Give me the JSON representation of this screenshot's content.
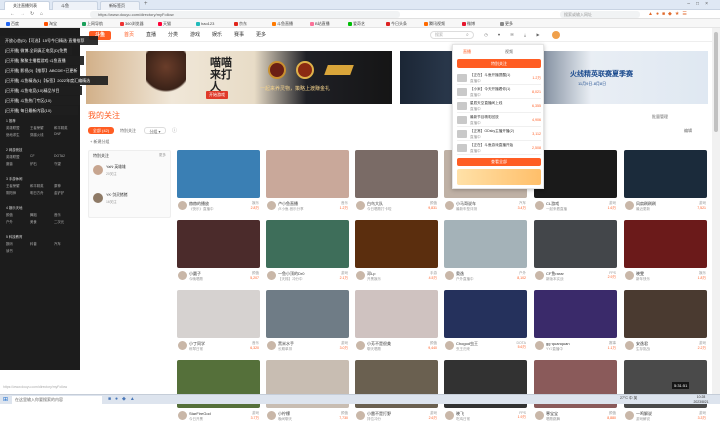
{
  "browser": {
    "tabs": [
      "关注直播列表",
      "斗鱼",
      "新标签页"
    ],
    "url": "https://www.douyu.com/directory/myFollow",
    "address_label": "搜索或输入网址",
    "bookmarks": [
      "百度",
      "淘宝",
      "上网导航",
      "360浏览器",
      "天猫",
      "hao123",
      "京东",
      "斗鱼直播",
      "B站直播",
      "爱奇艺",
      "今日头条",
      "腾讯视频",
      "微博",
      "更多"
    ]
  },
  "site": {
    "logo": "斗鱼",
    "nav": [
      "首页",
      "直播",
      "分类",
      "游戏",
      "娱乐",
      "赛事",
      "更多"
    ],
    "search_placeholder": "搜索",
    "header_icons": [
      "历史",
      "关注",
      "消息",
      "下载",
      "开播"
    ]
  },
  "banner": {
    "tag": "开始游戏",
    "text_left": "喵喵来打人",
    "text_mid": "一起来养灵物，策略上渡赚金礼",
    "text_right": "火线精英联赛夏季赛",
    "date_right": "11月9日-8月8日"
  },
  "sidebar": {
    "overlay_items": [
      "开放心态(D)【可选】15号今日精选·直播推荐",
      "[已开播] 微博-全网真正电竞(D)免费",
      "[已开播] 聚聚主播看游戏·斗鱼直播",
      "[已开播] 影视(0)【推荐】ABCDE+已更新",
      "[已开播] 斗鱼精选(1)【标签】2022年度汇编精选",
      "[已开播] 斗鱼电竞(10)精品节目",
      "[已开播] 斗鱼热门专区(10)",
      "[已开播] 每日最新内容(10)"
    ],
    "sections": [
      {
        "title": "1 推荐",
        "items": [
          "英雄联盟",
          "王者荣耀",
          "和平精英",
          "绝地求生",
          "穿越火线",
          "DNF"
        ]
      },
      {
        "title": "2 网游竞技",
        "items": [
          "英雄联盟",
          "CF",
          "DOTA2",
          "魔兽",
          "炉石",
          "守望"
        ]
      },
      {
        "title": "3 手游休闲",
        "items": [
          "王者荣耀",
          "和平精英",
          "原神",
          "阴阳师",
          "明日方舟",
          "金铲铲"
        ]
      },
      {
        "title": "4 娱乐天地",
        "items": [
          "颜值",
          "舞蹈",
          "音乐",
          "户外",
          "美食",
          "二次元"
        ]
      },
      {
        "title": "5 科技教育",
        "items": [
          "数码",
          "科普",
          "汽车",
          "读书"
        ]
      }
    ],
    "footer": "https://www.douyu.com/directory/myFollow"
  },
  "main": {
    "title": "我的关注",
    "filters": [
      "全部 (42)",
      "特别关注",
      "分组"
    ],
    "add_group": "+ 新建分组",
    "top_right_actions": [
      "批量管理",
      "编辑"
    ],
    "card_small_label": "更多",
    "special_card": {
      "header": "特别关注",
      "items": [
        {
          "name": "YaN·英雄雄",
          "meta": "20关注"
        },
        {
          "name": "YK·剑灵猪猪",
          "meta": "16关注"
        }
      ]
    },
    "cards": [
      {
        "name": "赫赫的播放",
        "meta": "《快乐》直播中",
        "heat": "2.8万",
        "tag": "娱乐",
        "color": "#3a7fb4"
      },
      {
        "name": "卢小鱼直播",
        "meta": "卢小鱼-音乐分享",
        "heat": "1.2万",
        "tag": "音乐",
        "color": "#c9a89a"
      },
      {
        "name": "白鸟大队",
        "meta": "今日唱歌打卡啦",
        "heat": "9,831",
        "tag": "颜值",
        "color": "#7a6b66"
      },
      {
        "name": "小马哥说车",
        "meta": "最新车型评测",
        "heat": "3.4万",
        "tag": "汽车",
        "color": "#bfb1a5"
      },
      {
        "name": "CL游戏",
        "meta": "一起来看直播",
        "heat": "1.6万",
        "tag": "游戏",
        "color": "#1a1a1a"
      },
      {
        "name": "风扇刷刷刷",
        "meta": "最近更新",
        "heat": "7,521",
        "tag": "游戏",
        "color": "#1b2b3b"
      },
      {
        "name": "小圆子",
        "meta": "今晚唱歌",
        "heat": "5,207",
        "tag": "颜值",
        "color": "#4b2b2b"
      },
      {
        "name": "一鱼小顶的Dr0",
        "meta": "【天梯】冲分中",
        "heat": "2.1万",
        "tag": "游戏",
        "color": "#3e6e5a"
      },
      {
        "name": "邓Lp",
        "meta": "开黑娱乐",
        "heat": "4.5万",
        "tag": "手游",
        "color": "#5b2e0e"
      },
      {
        "name": "奥逸",
        "meta": "户外直播中",
        "heat": "8,102",
        "tag": "户外",
        "color": "#a4b2b8"
      },
      {
        "name": "CF鱼rarar",
        "meta": "新版本实战",
        "heat": "2.9万",
        "tag": "FPS",
        "color": "#43464a"
      },
      {
        "name": "晓雯",
        "meta": "新年快乐",
        "heat": "1.8万",
        "tag": "娱乐",
        "color": "#6b1a1a"
      },
      {
        "name": "小丁同学",
        "meta": "练琴日常",
        "heat": "6,320",
        "tag": "音乐",
        "color": "#d6d2d0"
      },
      {
        "name": "黑米水手",
        "meta": "长期单排",
        "heat": "3.0万",
        "tag": "游戏",
        "color": "#6f7c86"
      },
      {
        "name": "小芳不是很美",
        "meta": "聊天唱歌",
        "heat": "9,440",
        "tag": "颜值",
        "color": "#cfc2c0"
      },
      {
        "name": "Chogod虫王",
        "meta": "虫王归来",
        "heat": "5.6万",
        "tag": "DOTA",
        "color": "#25315c"
      },
      {
        "name": "gg·quanquan",
        "meta": "YYJ直播中",
        "heat": "1.1万",
        "tag": "赛事",
        "color": "#3a2a6a"
      },
      {
        "name": "安逸君",
        "meta": "生存挑战",
        "heat": "2.2万",
        "tag": "游戏",
        "color": "#4a3a30"
      },
      {
        "name": "StarFireGod",
        "meta": "今日开黑",
        "heat": "3.7万",
        "tag": "游戏",
        "color": "#55703a"
      },
      {
        "name": "小柠檬",
        "meta": "晚间聊天",
        "heat": "7,730",
        "tag": "颜值",
        "color": "#c8bdb2"
      },
      {
        "name": "小雷不是打野",
        "meta": "排位冲分",
        "heat": "2.6万",
        "tag": "游戏",
        "color": "#6a6050"
      },
      {
        "name": "晓飞",
        "meta": "吃鸡日常",
        "heat": "1.9万",
        "tag": "FPS",
        "color": "#323232"
      },
      {
        "name": "寒宝宝",
        "meta": "唱歌跳舞",
        "heat": "8,880",
        "tag": "颜值",
        "color": "#8a5a5a"
      },
      {
        "name": "一鸣解说",
        "meta": "游戏解说",
        "heat": "3.3万",
        "tag": "游戏",
        "color": "#4a4a4a"
      },
      {
        "name": "小熊猫",
        "meta": "新年直播",
        "heat": "1.0万",
        "tag": "娱乐",
        "color": "#d8c3b5"
      },
      {
        "name": "萌小二",
        "meta": "今天打游戏",
        "heat": "6,600",
        "tag": "游戏",
        "color": "#a45a34"
      },
      {
        "name": "九号",
        "meta": "比赛重播",
        "heat": "2.0万",
        "tag": "赛事",
        "color": "#3b5a3a"
      },
      {
        "name": "木子",
        "meta": "美食分享",
        "heat": "4,210",
        "tag": "美食",
        "color": "#b48a6a"
      },
      {
        "name": "夏天",
        "meta": "一起看",
        "heat": "3,500",
        "tag": "娱乐",
        "color": "#e2d6cf"
      },
      {
        "name": "明明",
        "meta": "直播中",
        "heat": "1.5万",
        "tag": "颜值",
        "color": "#5a4a6a"
      }
    ]
  },
  "dropdown": {
    "tabs": [
      "直播",
      "视频"
    ],
    "title": "特别关注",
    "rows": [
      {
        "title": "【正在】斗鱼开播提醒(1)",
        "sub": "直播中",
        "count": "1.2万"
      },
      {
        "title": "【小米】今天开播看你(1)",
        "sub": "直播中",
        "count": "8,021"
      },
      {
        "title": "星辰天空直播间上线",
        "sub": "直播中",
        "count": "6,355"
      },
      {
        "title": "最新节目精彩回放",
        "sub": "直播中",
        "count": "4,906"
      },
      {
        "title": "【正常】GDsky主播开播(2)",
        "sub": "直播中",
        "count": "3,112"
      },
      {
        "title": "【正在】斗鱼游戏直播开始",
        "sub": "直播中",
        "count": "2,508"
      }
    ],
    "button": "查看全部"
  },
  "taskbar": {
    "search": "在这里输入你要搜索的内容",
    "time": "10:28",
    "date": "2023/8/21",
    "tray": [
      "27°C",
      "中",
      "英"
    ],
    "video_badge": "5:31:51"
  }
}
